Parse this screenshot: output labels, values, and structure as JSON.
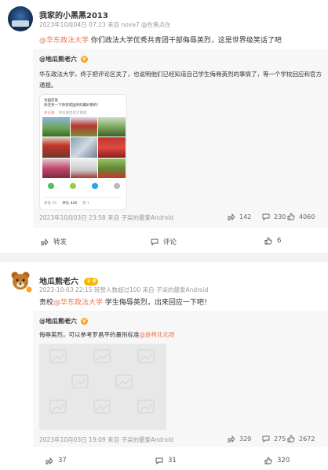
{
  "post1": {
    "author": "我家的小黑黑2013",
    "meta": "2023年10月04日 07:23 来自 nova7 @在焦点在",
    "mention": "@华东政法大学",
    "text": " 你们政法大学优秀共青团干部侮辱英烈，这是世界级笑话了吧",
    "repost": {
      "author": "@地瓜熊老六",
      "text": "华东政法大学，终于把评论区关了，也说明他们已经知道自己学生侮辱英烈的事情了，等一个学校回应和官方通报。",
      "meta": "2023年10月03日 23:58 来自 子柒的最爱Android",
      "shares": "142",
      "comments": "230",
      "likes": "4060",
      "screenshot": {
        "top_label": "为国庆发",
        "question": "你还有一下你觉得国庆的最好看的!",
        "tabs": [
          "评论组",
          "评论进出的文章组"
        ],
        "stats": [
          "转发 26",
          "评论 426",
          "赞 1"
        ]
      }
    },
    "actions": {
      "repost": "转发",
      "comment": "评论",
      "like": "6"
    }
  },
  "post2": {
    "author": "地瓜熊老六",
    "badge": "8",
    "meta": "2023-10-03 22:15 转赞人数超过100 来自 子柒的最爱Android",
    "text_prefix": "贵校",
    "mention": "@华东政法大学",
    "text_suffix": " 学生侮辱英烈，出来回应一下吧！",
    "repost": {
      "author": "@地瓜熊老六",
      "text_prefix": "侮辱英烈，可以参考罗昌平的量刑标准",
      "mention": "@是柯北北呀",
      "meta": "2023年10月03日 19:09 来自 子柒的最爱Android",
      "shares": "329",
      "comments": "275",
      "likes": "2672"
    },
    "actions": {
      "repost": "37",
      "comment": "31",
      "like": "320"
    }
  },
  "colors": {
    "link": "#eb7350",
    "background": "#f2f2f2",
    "repost_bg": "#f7f7f7"
  }
}
